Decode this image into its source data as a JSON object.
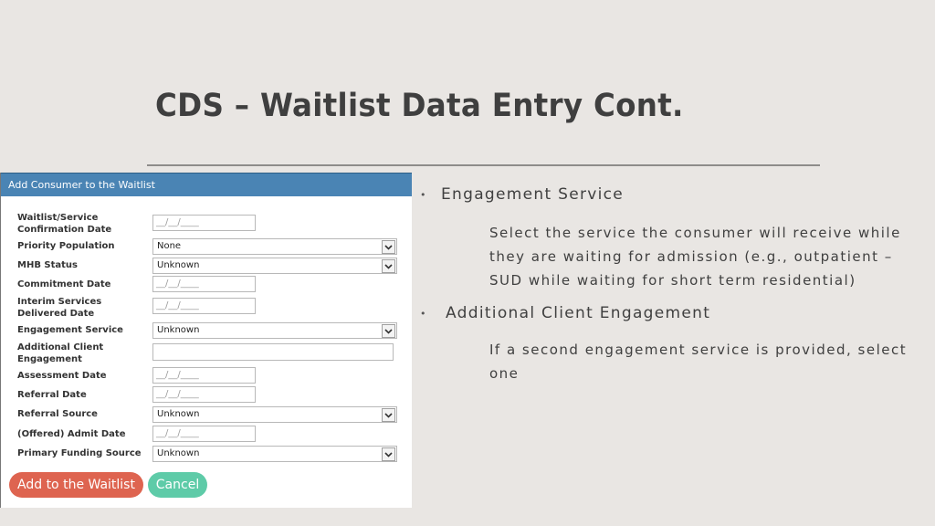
{
  "slide": {
    "title": "CDS – Waitlist Data Entry Cont."
  },
  "form": {
    "header": "Add Consumer to the Waitlist",
    "fields": [
      {
        "label": "Waitlist/Service Confirmation Date",
        "type": "date",
        "value": "__/__/____"
      },
      {
        "label": "Priority Population",
        "type": "select",
        "value": "None"
      },
      {
        "label": "MHB Status",
        "type": "select",
        "value": "Unknown"
      },
      {
        "label": "Commitment Date",
        "type": "date",
        "value": "__/__/____"
      },
      {
        "label": "Interim Services Delivered Date",
        "type": "date",
        "value": "__/__/____"
      },
      {
        "label": "Engagement Service",
        "type": "select",
        "value": "Unknown"
      },
      {
        "label": "Additional Client Engagement",
        "type": "text",
        "value": ""
      },
      {
        "label": "Assessment Date",
        "type": "date",
        "value": "__/__/____"
      },
      {
        "label": "Referral Date",
        "type": "date",
        "value": "__/__/____"
      },
      {
        "label": "Referral Source",
        "type": "select",
        "value": "Unknown"
      },
      {
        "label": "(Offered) Admit Date",
        "type": "date",
        "value": "__/__/____"
      },
      {
        "label": "Primary Funding Source",
        "type": "select",
        "value": "Unknown"
      }
    ],
    "buttons": {
      "add": "Add to the Waitlist",
      "cancel": "Cancel"
    }
  },
  "notes": [
    {
      "bullet": "•",
      "heading": "Engagement Service",
      "body": "Select the service the consumer will receive while they are waiting for admission (e.g., outpatient – SUD while waiting for short term residential)"
    },
    {
      "bullet": "•",
      "heading": "Additional Client Engagement",
      "body": "If a second engagement service is provided, select one"
    }
  ],
  "colors": {
    "header_blue": "#4a84b4",
    "add_button": "#de6450",
    "cancel_button": "#5ecba8",
    "background": "#e9e6e3"
  }
}
